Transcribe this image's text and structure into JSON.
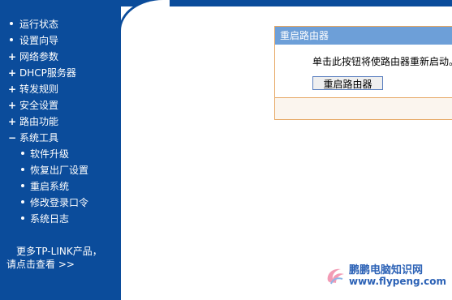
{
  "colors": {
    "sidebar_bg": "#0b4c9b",
    "panel_title_bg": "#6d9fd8",
    "panel_border": "#e6a661",
    "watermark": "#2c62b6"
  },
  "sidebar": {
    "items": [
      {
        "label": "运行状态",
        "marker": "bullet"
      },
      {
        "label": "设置向导",
        "marker": "bullet"
      },
      {
        "label": "网络参数",
        "marker": "plus"
      },
      {
        "label": "DHCP服务器",
        "marker": "plus"
      },
      {
        "label": "转发规则",
        "marker": "plus"
      },
      {
        "label": "安全设置",
        "marker": "plus"
      },
      {
        "label": "路由功能",
        "marker": "plus"
      },
      {
        "label": "系统工具",
        "marker": "minus"
      }
    ],
    "sub_items": [
      {
        "label": "软件升级"
      },
      {
        "label": "恢复出厂设置"
      },
      {
        "label": "重启系统"
      },
      {
        "label": "修改登录口令"
      },
      {
        "label": "系统日志"
      }
    ],
    "more_line1": "更多TP-LINK产品，",
    "more_line2": "请点击查看 >>"
  },
  "panel": {
    "title": "重启路由器",
    "description": "单击此按钮将使路由器重新启动。",
    "button_label": "重启路由器"
  },
  "watermark": {
    "title": "鹏鹏电脑知识网",
    "url": "www.flypeng.com"
  }
}
